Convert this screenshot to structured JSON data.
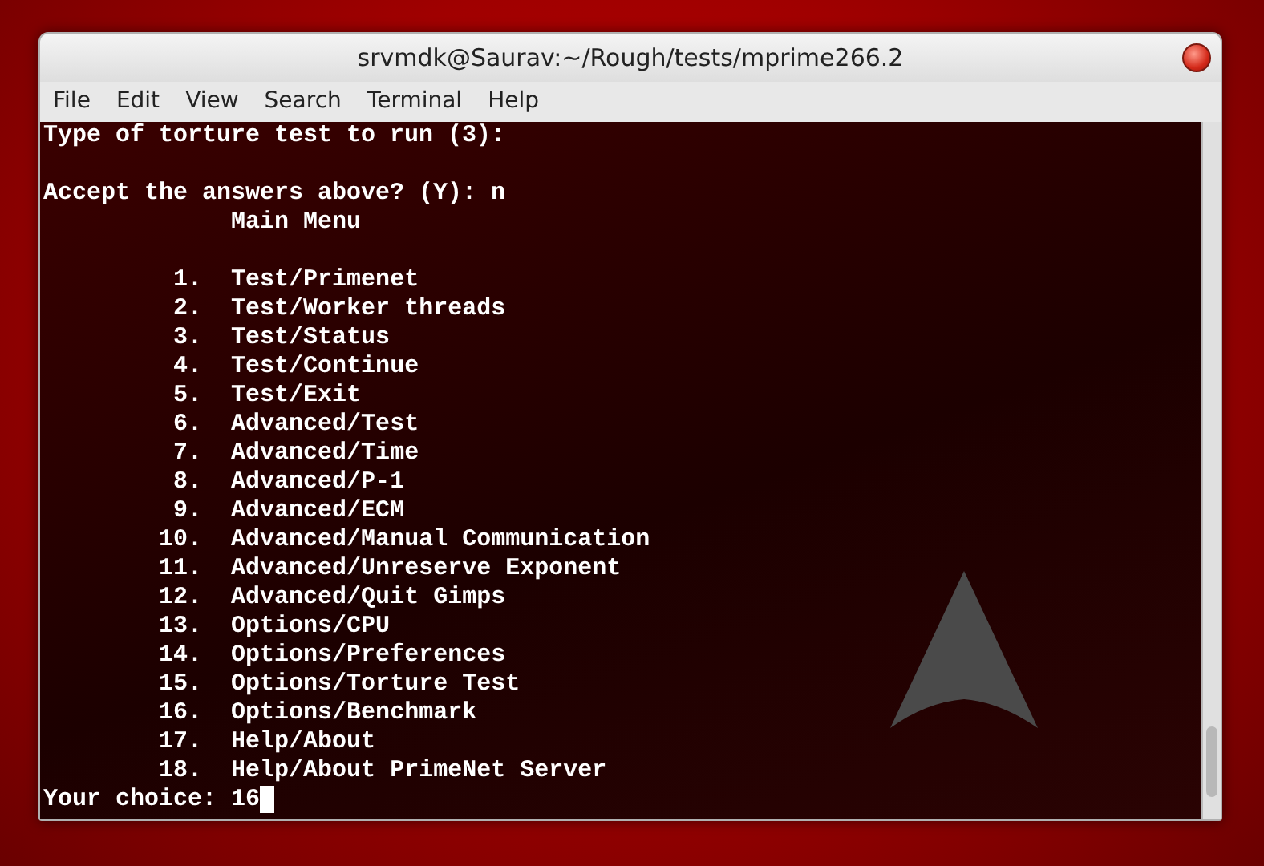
{
  "window": {
    "title": "srvmdk@Saurav:~/Rough/tests/mprime266.2"
  },
  "menu_bar": [
    "File",
    "Edit",
    "View",
    "Search",
    "Terminal",
    "Help"
  ],
  "terminal": {
    "line_groups": [
      [
        "Type of torture test to run (3):"
      ],
      [
        "Accept the answers above? (Y): n"
      ]
    ],
    "main_menu": {
      "title": "Main Menu",
      "items": [
        {
          "number": "1.",
          "label": "Test/Primenet"
        },
        {
          "number": "2.",
          "label": "Test/Worker threads"
        },
        {
          "number": "3.",
          "label": "Test/Status"
        },
        {
          "number": "4.",
          "label": "Test/Continue"
        },
        {
          "number": "5.",
          "label": "Test/Exit"
        },
        {
          "number": "6.",
          "label": "Advanced/Test"
        },
        {
          "number": "7.",
          "label": "Advanced/Time"
        },
        {
          "number": "8.",
          "label": "Advanced/P-1"
        },
        {
          "number": "9.",
          "label": "Advanced/ECM"
        },
        {
          "number": "10.",
          "label": "Advanced/Manual Communication"
        },
        {
          "number": "11.",
          "label": "Advanced/Unreserve Exponent"
        },
        {
          "number": "12.",
          "label": "Advanced/Quit Gimps"
        },
        {
          "number": "13.",
          "label": "Options/CPU"
        },
        {
          "number": "14.",
          "label": "Options/Preferences"
        },
        {
          "number": "15.",
          "label": "Options/Torture Test"
        },
        {
          "number": "16.",
          "label": "Options/Benchmark"
        },
        {
          "number": "17.",
          "label": "Help/About"
        },
        {
          "number": "18.",
          "label": "Help/About PrimeNet Server"
        }
      ]
    },
    "prompt": {
      "label": "Your choice:",
      "value": "16"
    }
  }
}
